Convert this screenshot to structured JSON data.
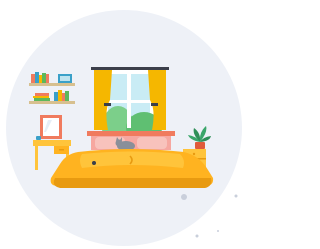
{
  "illustration": {
    "subject": "bedroom-illustration",
    "palette": {
      "backdrop": "#eef1f7",
      "curtain": "#f5b700",
      "window_frame": "#ffffff",
      "sky": "#c9ecf5",
      "hill": "#7ccf8a",
      "wall_stripe": "#f07b5e",
      "bed": "#ffb320",
      "bed_shadow": "#e89a10",
      "pillow": "#f6a7a0",
      "desk": "#ffc43b",
      "mirror_frame": "#f07b5e",
      "shelf": "#d7c08f",
      "plant": "#2f8f58",
      "pot": "#e05b3a",
      "cat": "#8a8f99"
    },
    "icons": [
      "bookshelf-icon",
      "window-icon",
      "curtain-icon",
      "bed-icon",
      "cat-icon",
      "desk-icon",
      "mirror-icon",
      "plant-icon",
      "nightstand-icon"
    ]
  }
}
